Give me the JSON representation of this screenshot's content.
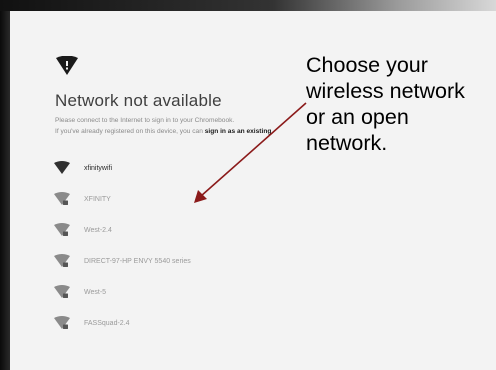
{
  "page": {
    "title": "Network not available",
    "description_line1": "Please connect to the Internet to sign in to your Chromebook.",
    "description_line2_prefix": "If you've already registered on this device, you can ",
    "sign_in_link": "sign in as an existing"
  },
  "networks": [
    {
      "name": "xfinitywifi",
      "icon": "wifi-open-icon"
    },
    {
      "name": "XFINITY",
      "icon": "wifi-lock-icon"
    },
    {
      "name": "West-2.4",
      "icon": "wifi-lock-icon"
    },
    {
      "name": "DIRECT-97-HP ENVY 5540 series",
      "icon": "wifi-lock-icon"
    },
    {
      "name": "West-5",
      "icon": "wifi-lock-icon"
    },
    {
      "name": "FASSquad-2.4",
      "icon": "wifi-lock-icon"
    }
  ],
  "annotation": {
    "text": "Choose your wireless network or an open network.",
    "color": "#8b1a1a"
  }
}
